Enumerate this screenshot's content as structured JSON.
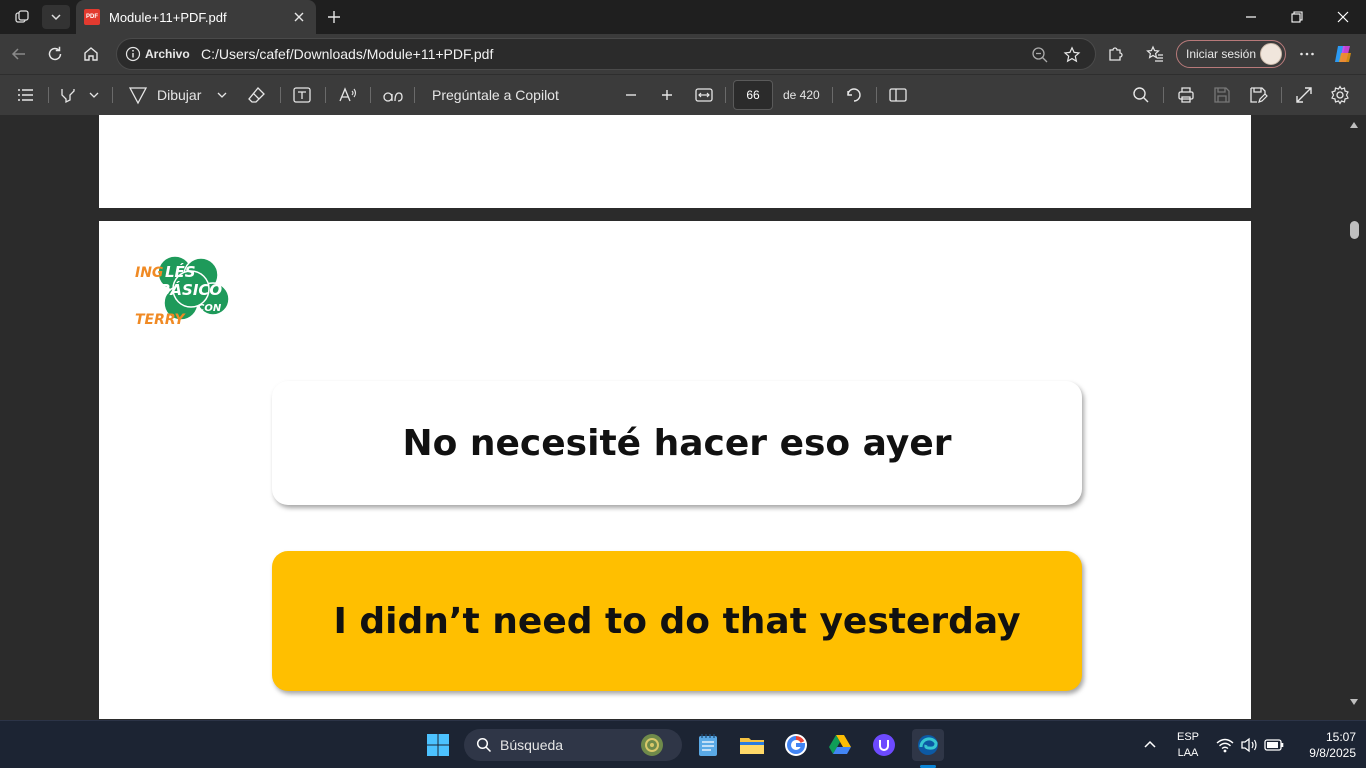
{
  "browser": {
    "tab_title": "Module+11+PDF.pdf",
    "tab_favicon_text": "PDF",
    "omnibox_label": "Archivo",
    "url": "C:/Users/cafef/Downloads/Module+11+PDF.pdf",
    "signin_label": "Iniciar sesión"
  },
  "pdf_toolbar": {
    "draw_label": "Dibujar",
    "copilot_label": "Pregúntale a Copilot",
    "page_number": "66",
    "page_total": "de 420"
  },
  "document": {
    "logo_text": {
      "line1": "INGLÉS",
      "line2": "BÁSICO",
      "line3": "CON",
      "line4": "TERRY"
    },
    "spanish_sentence": "No necesité hacer eso ayer",
    "english_sentence": "I didn’t need to do that yesterday",
    "english_card_color": "#ffbf00"
  },
  "taskbar": {
    "search_placeholder": "Búsqueda",
    "language_line1": "ESP",
    "language_line2": "LAA",
    "time": "15:07",
    "date": "9/8/2025"
  },
  "colors": {
    "accent_edge": "#0a84d6",
    "logo_green": "#1e9a5a",
    "logo_orange": "#f08a24"
  }
}
